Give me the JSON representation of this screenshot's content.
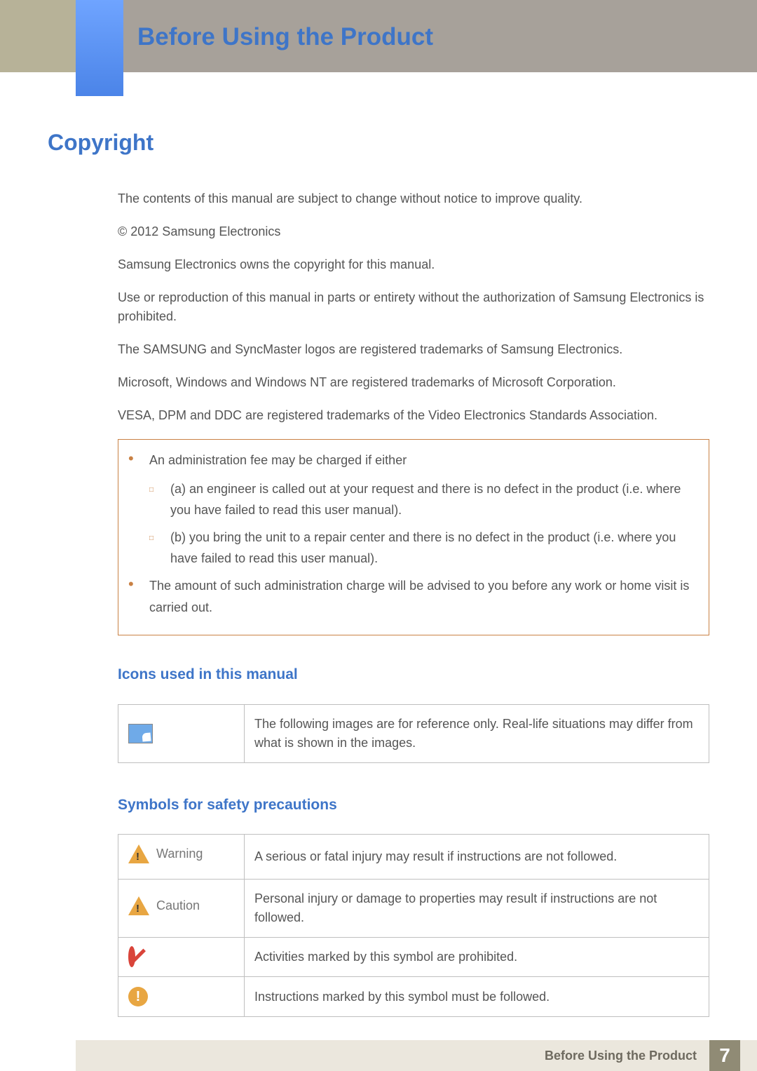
{
  "header": {
    "title": "Before Using the Product"
  },
  "section": {
    "title": "Copyright"
  },
  "paragraphs": [
    "The contents of this manual are subject to change without notice to improve quality.",
    "© 2012 Samsung Electronics",
    "Samsung Electronics owns the copyright for this manual.",
    "Use or reproduction of this manual in parts or entirety without the authorization of Samsung Electronics is prohibited.",
    "The SAMSUNG and SyncMaster logos are registered trademarks of Samsung Electronics.",
    "Microsoft, Windows and Windows NT are registered trademarks of Microsoft Corporation.",
    "VESA, DPM and DDC are registered trademarks of the Video Electronics Standards Association."
  ],
  "box": {
    "bullet1": "An administration fee may be charged if either",
    "sub_a": "(a) an engineer is called out at your request and there is no defect in the product (i.e. where you have failed to read this user manual).",
    "sub_b": "(b) you bring the unit to a repair center and there is no defect in the product (i.e. where you have failed to read this user manual).",
    "bullet2": "The amount of such administration charge will be advised to you before any work or home visit is carried out."
  },
  "icons_section": {
    "heading": "Icons used in this manual",
    "note_desc": "The following images are for reference only. Real-life situations may differ from what is shown in the images."
  },
  "symbols_section": {
    "heading": "Symbols for safety precautions",
    "rows": [
      {
        "label": "Warning",
        "desc": "A serious or fatal injury may result if instructions are not followed."
      },
      {
        "label": "Caution",
        "desc": "Personal injury or damage to properties may result if instructions are not followed."
      },
      {
        "label": "",
        "desc": "Activities marked by this symbol are prohibited."
      },
      {
        "label": "",
        "desc": "Instructions marked by this symbol must be followed."
      }
    ]
  },
  "footer": {
    "label": "Before Using the Product",
    "page": "7"
  }
}
